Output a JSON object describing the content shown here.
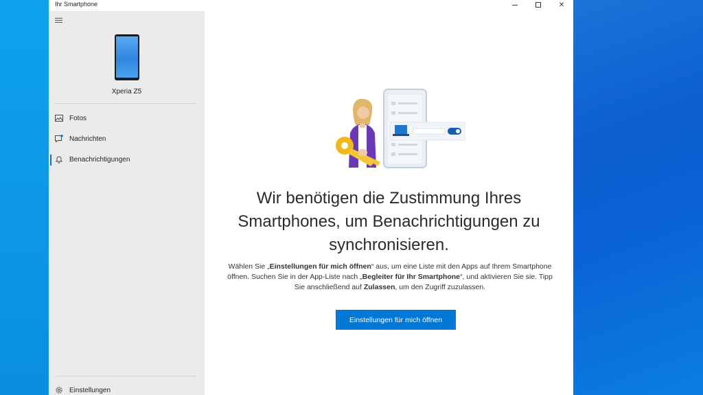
{
  "window": {
    "title": "Ihr Smartphone",
    "controls": {
      "minimize": "minimize",
      "maximize": "maximize",
      "close": "✕"
    }
  },
  "sidebar": {
    "device_name": "Xperia Z5",
    "items": [
      {
        "label": "Fotos",
        "icon": "photo-icon"
      },
      {
        "label": "Nachrichten",
        "icon": "message-icon"
      },
      {
        "label": "Benachrichtigungen",
        "icon": "bell-icon",
        "active": true
      }
    ],
    "settings_label": "Einstellungen"
  },
  "main": {
    "headline_lines": [
      "Wir benötigen die Zustimmung Ihres",
      "Smartphones, um Benachrichtigungen zu",
      "synchronisieren."
    ],
    "desc": {
      "l1_pre": "Wählen Sie „",
      "l1_bold": "Einstellungen für mich öffnen",
      "l1_post": "“ aus, um eine Liste mit den Apps auf Ihrem Smartphone",
      "l2_pre": "öffnen. Suchen Sie in der App-Liste nach „",
      "l2_bold": "Begleiter für Ihr Smartphone",
      "l2_post": "“, und aktivieren Sie sie. Tipp",
      "l3_pre": "Sie anschließend auf ",
      "l3_bold": "Zulassen",
      "l3_post": ", um den Zugriff zuzulassen."
    },
    "button_label": "Einstellungen für mich öffnen"
  },
  "colors": {
    "accent": "#0078d7",
    "sidebar_bg": "#ebebeb",
    "desktop_blue": "#0a8ee0"
  }
}
